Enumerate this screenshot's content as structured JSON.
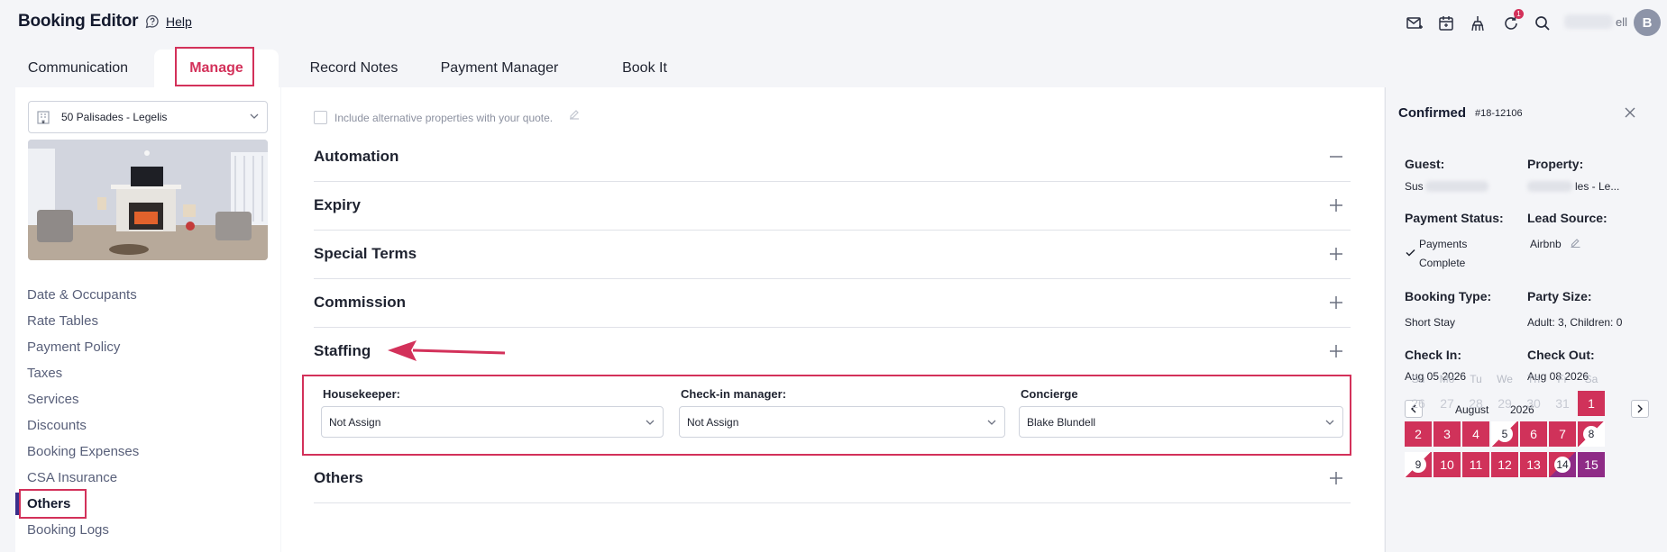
{
  "header": {
    "title": "Booking Editor",
    "help_label": "Help",
    "user_name_suffix": "ell",
    "avatar_initial": "B",
    "notification_count": "1",
    "icons": [
      "mail-icon",
      "calendar-icon",
      "cleaning-icon",
      "refresh-icon",
      "search-icon"
    ]
  },
  "tabs": [
    {
      "label": "Communication"
    },
    {
      "label": "Manage"
    },
    {
      "label": "Record Notes"
    },
    {
      "label": "Payment Manager"
    },
    {
      "label": "Book It"
    }
  ],
  "sidebar": {
    "property": "50 Palisades - Legelis",
    "items": [
      {
        "label": "Date & Occupants"
      },
      {
        "label": "Rate Tables"
      },
      {
        "label": "Payment Policy"
      },
      {
        "label": "Taxes"
      },
      {
        "label": "Services"
      },
      {
        "label": "Discounts"
      },
      {
        "label": "Booking Expenses"
      },
      {
        "label": "CSA Insurance"
      },
      {
        "label": "Others"
      },
      {
        "label": "Booking Logs"
      }
    ]
  },
  "main": {
    "alt_properties_label": "Include alternative properties with your quote.",
    "sections": [
      {
        "title": "Automation",
        "state": "expanded"
      },
      {
        "title": "Expiry",
        "state": "collapsed"
      },
      {
        "title": "Special Terms",
        "state": "collapsed"
      },
      {
        "title": "Commission",
        "state": "collapsed"
      },
      {
        "title": "Staffing",
        "state": "collapsed"
      },
      {
        "title": "Others",
        "state": "collapsed"
      }
    ],
    "staffing": {
      "housekeeper": {
        "label": "Housekeeper:",
        "value": "Not Assign"
      },
      "checkin_manager": {
        "label": "Check-in manager:",
        "value": "Not Assign"
      },
      "concierge": {
        "label": "Concierge",
        "value": "Blake Blundell"
      }
    }
  },
  "booking": {
    "status": "Confirmed",
    "id": "#18-12106",
    "guest_label": "Guest:",
    "guest_value": "Sus",
    "property_label": "Property:",
    "property_value": "les - Le...",
    "payment_status_label": "Payment Status:",
    "payment_status_line1": "Payments",
    "payment_status_line2": "Complete",
    "lead_source_label": "Lead Source:",
    "lead_source_value": "Airbnb",
    "booking_type_label": "Booking Type:",
    "booking_type_value": "Short Stay",
    "party_size_label": "Party Size:",
    "party_size_value": "Adult: 3, Children: 0",
    "check_in_label": "Check In:",
    "check_in_value": "Aug 05 2026",
    "check_out_label": "Check Out:",
    "check_out_value": "Aug 08 2026"
  },
  "calendar": {
    "month": "August",
    "year": "2026",
    "weekdays": [
      "Su",
      "Mo",
      "Tu",
      "We",
      "Th",
      "Fr",
      "Sa"
    ],
    "rows": [
      [
        {
          "d": "26",
          "s": "muted"
        },
        {
          "d": "27",
          "s": "muted"
        },
        {
          "d": "28",
          "s": "muted"
        },
        {
          "d": "29",
          "s": "muted"
        },
        {
          "d": "30",
          "s": "muted"
        },
        {
          "d": "31",
          "s": "muted"
        },
        {
          "d": "1",
          "s": "red"
        }
      ],
      [
        {
          "d": "2",
          "s": "red"
        },
        {
          "d": "3",
          "s": "red"
        },
        {
          "d": "4",
          "s": "red"
        },
        {
          "d": "5",
          "s": "split-in-ring"
        },
        {
          "d": "6",
          "s": "red"
        },
        {
          "d": "7",
          "s": "red"
        },
        {
          "d": "8",
          "s": "split-out-ring"
        }
      ],
      [
        {
          "d": "9",
          "s": "split-in-ring"
        },
        {
          "d": "10",
          "s": "red"
        },
        {
          "d": "11",
          "s": "red"
        },
        {
          "d": "12",
          "s": "red"
        },
        {
          "d": "13",
          "s": "red"
        },
        {
          "d": "14",
          "s": "split-rp-ring"
        },
        {
          "d": "15",
          "s": "purple"
        }
      ]
    ]
  },
  "colors": {
    "accent": "#d3315a",
    "booked_red": "#d0325a",
    "booked_purple": "#8e2b86",
    "sidebar_marker": "#3a2f8c"
  }
}
